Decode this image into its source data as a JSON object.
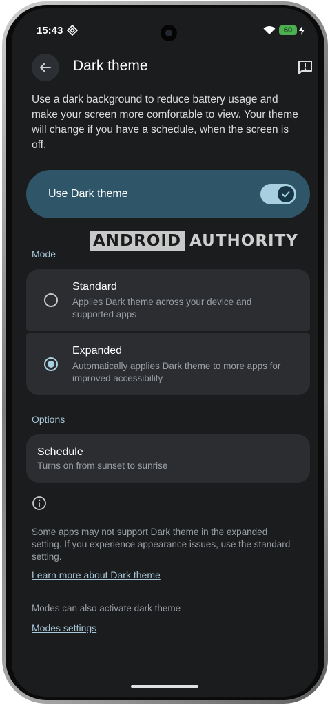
{
  "status_bar": {
    "time": "15:43",
    "battery_level": "60",
    "icons": [
      "nfc-icon",
      "wifi-icon",
      "battery-icon",
      "charging-bolt-icon"
    ]
  },
  "header": {
    "title": "Dark theme",
    "back_icon": "arrow-left-icon",
    "feedback_icon": "feedback-icon"
  },
  "description": "Use a dark background to reduce battery usage and make your screen more comfortable to view. Your theme will change if you have a schedule, when the screen is off.",
  "dark_toggle": {
    "label": "Use Dark theme",
    "enabled": true
  },
  "watermark": {
    "part1": "ANDROID",
    "part2": "AUTHORITY"
  },
  "mode": {
    "label": "Mode",
    "options": [
      {
        "title": "Standard",
        "subtitle": "Applies Dark theme across your device and supported apps",
        "selected": false
      },
      {
        "title": "Expanded",
        "subtitle": "Automatically applies Dark theme to more apps for improved accessibility",
        "selected": true
      }
    ]
  },
  "options": {
    "label": "Options",
    "schedule_title": "Schedule",
    "schedule_subtitle": "Turns on from sunset to sunrise"
  },
  "info": {
    "icon": "info-icon",
    "text": "Some apps may not support Dark theme in the expanded setting. If you experience appearance issues, use the standard setting.",
    "learn_more": "Learn more about Dark theme",
    "modes_text": "Modes can also activate dark theme",
    "modes_link": "Modes settings"
  },
  "colors": {
    "background": "#1a1c1e",
    "accent": "#a8c8da",
    "toggle_card": "#2e5668",
    "card": "#2b2d30"
  }
}
